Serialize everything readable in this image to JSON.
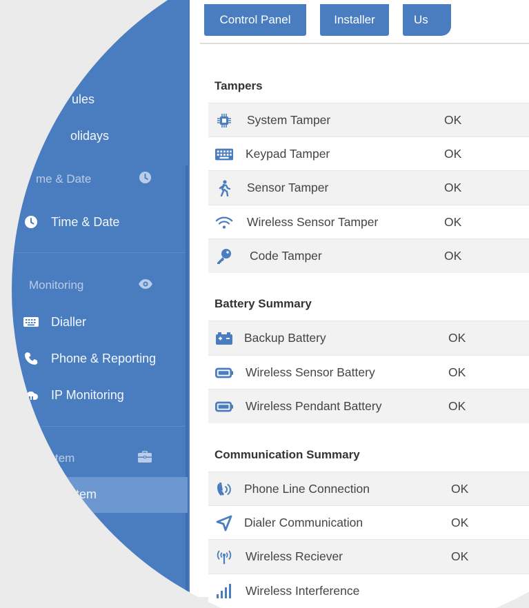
{
  "tabs": [
    {
      "label": "Control Panel"
    },
    {
      "label": "Installer"
    },
    {
      "label": "Us"
    }
  ],
  "sidebar": {
    "items_top": [
      {
        "label": "ules",
        "icon": "calendar-icon"
      },
      {
        "label": "olidays",
        "icon": "calendar-icon"
      }
    ],
    "time_header": {
      "label": "me & Date",
      "icon": "clock-icon"
    },
    "time_item": {
      "label": "Time & Date",
      "icon": "clock-icon"
    },
    "monitoring_header": {
      "label": "Monitoring",
      "icon": "eye-icon"
    },
    "monitoring_items": [
      {
        "label": "Dialler",
        "icon": "keyboard-icon"
      },
      {
        "label": "Phone & Reporting",
        "icon": "phone-icon"
      },
      {
        "label": "IP Monitoring",
        "icon": "cloud-icon"
      }
    ],
    "system_header": {
      "label": "tem",
      "icon": "briefcase-icon"
    },
    "system_item": {
      "label": "tem"
    }
  },
  "sections": {
    "tampers": {
      "title": "Tampers",
      "rows": [
        {
          "label": "System Tamper",
          "status": "OK",
          "icon": "chip-icon"
        },
        {
          "label": "Keypad Tamper",
          "status": "OK",
          "icon": "keyboard-icon"
        },
        {
          "label": "Sensor Tamper",
          "status": "OK",
          "icon": "walking-person-icon"
        },
        {
          "label": "Wireless Sensor Tamper",
          "status": "OK",
          "icon": "wifi-icon"
        },
        {
          "label": "Code Tamper",
          "status": "OK",
          "icon": "key-icon"
        }
      ]
    },
    "battery": {
      "title": "Battery Summary",
      "rows": [
        {
          "label": "Backup Battery",
          "status": "OK",
          "icon": "car-battery-icon"
        },
        {
          "label": "Wireless Sensor Battery",
          "status": "OK",
          "icon": "battery-icon"
        },
        {
          "label": "Wireless Pendant Battery",
          "status": "OK",
          "icon": "battery-icon"
        }
      ]
    },
    "communication": {
      "title": "Communication Summary",
      "rows": [
        {
          "label": "Phone Line Connection",
          "status": "OK",
          "icon": "phone-volume-icon"
        },
        {
          "label": "Dialer Communication",
          "status": "OK",
          "icon": "location-arrow-icon"
        },
        {
          "label": "Wireless Reciever",
          "status": "OK",
          "icon": "antenna-icon"
        },
        {
          "label": "Wireless Interference",
          "status": "",
          "icon": "signal-bars-icon"
        }
      ]
    }
  },
  "colors": {
    "primary": "#4a7dbf",
    "sidebar_active": "#6c98cf",
    "icon": "#4a7dbf",
    "row_alt": "#f2f2f2"
  }
}
